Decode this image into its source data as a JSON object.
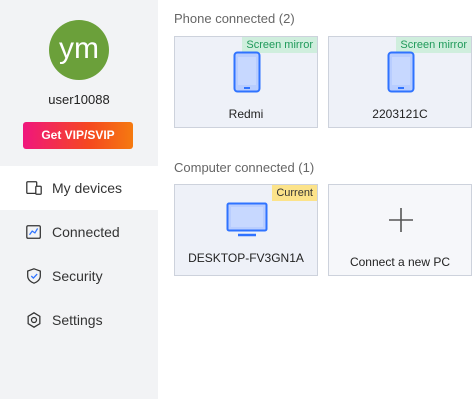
{
  "colors": {
    "accent": "#2f73ff",
    "avatar_bg": "#6ba03a",
    "vip_gradient_start": "#f0167d",
    "vip_gradient_end": "#f57a10",
    "mirror_badge_text": "#1f9a5a",
    "current_badge_bg": "#fce38a"
  },
  "profile": {
    "initials": "ym",
    "username": "user10088",
    "vip_label": "Get VIP/SVIP"
  },
  "nav": {
    "items": [
      {
        "label": "My devices",
        "icon": "devices-icon",
        "active": true
      },
      {
        "label": "Connected",
        "icon": "connected-icon",
        "active": false
      },
      {
        "label": "Security",
        "icon": "shield-icon",
        "active": false
      },
      {
        "label": "Settings",
        "icon": "gear-icon",
        "active": false
      }
    ]
  },
  "phones": {
    "title": "Phone connected (2)",
    "devices": [
      {
        "name": "Redmi",
        "badge": "Screen mirror",
        "icon": "phone-icon"
      },
      {
        "name": "2203121C",
        "badge": "Screen mirror",
        "icon": "phone-icon"
      }
    ]
  },
  "computers": {
    "title": "Computer connected (1)",
    "devices": [
      {
        "name": "DESKTOP-FV3GN1A",
        "badge": "Current",
        "icon": "monitor-icon"
      }
    ],
    "add_label": "Connect a new PC",
    "add_icon": "plus-icon"
  }
}
